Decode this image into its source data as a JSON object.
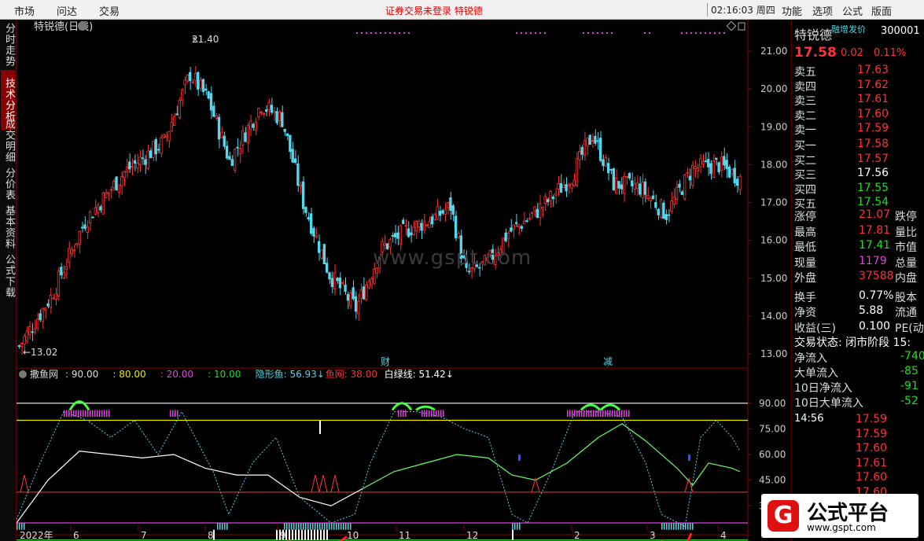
{
  "topbar": {
    "menu_left": [
      "市场",
      "问达",
      "交易"
    ],
    "notice": "证券交易未登录  特锐德",
    "clock": "02:16:03 周四",
    "menu_right": [
      "功能",
      "选项",
      "公式",
      "版面"
    ]
  },
  "left_tabs": [
    {
      "label": "分时走势",
      "active": false
    },
    {
      "label": "技术分析",
      "active": true
    },
    {
      "label": "成交明细",
      "active": false
    },
    {
      "label": "分价表",
      "active": false
    },
    {
      "label": "基本资料",
      "active": false
    },
    {
      "label": "公式下载",
      "active": false
    }
  ],
  "main_chart": {
    "title": "特锐德(日线)",
    "high_label": "21.40",
    "low_label": "←13.02",
    "y_ticks": [
      "21.00",
      "20.00",
      "19.00",
      "18.00",
      "17.00",
      "16.00",
      "15.00",
      "14.00",
      "13.00"
    ],
    "y_values": [
      21,
      20,
      19,
      18,
      17,
      16,
      15,
      14,
      13
    ],
    "event_labels": [
      "财",
      "减"
    ]
  },
  "sub_chart": {
    "indicator_name": "撒鱼网",
    "params": [
      {
        "text": ": 90.00",
        "color": "#dddddd"
      },
      {
        "text": ": 80.00",
        "color": "#e8e800"
      },
      {
        "text": ": 20.00",
        "color": "#e040e0"
      },
      {
        "text": ": 10.00",
        "color": "#22dd22"
      },
      {
        "text": "隐形鱼: 56.93↓",
        "color": "#5cd0e0"
      },
      {
        "text": "鱼网: 38.00",
        "color": "#ff3333"
      },
      {
        "text": "白绿线: 51.42↓",
        "color": "#ffffff"
      }
    ],
    "y_ticks": [
      "90.00",
      "75.00",
      "60.00",
      "45.00",
      "30.00"
    ],
    "y_values": [
      90,
      75,
      60,
      45,
      30
    ]
  },
  "x_axis": [
    "2022年",
    "6",
    "7",
    "8",
    "9",
    "10",
    "11",
    "12",
    "2",
    "3",
    "4"
  ],
  "watermark": "www.gspt.com",
  "quote": {
    "name": "特锐德",
    "badge": "融增发价",
    "code": "300001",
    "price": "17.58",
    "change": "0.02",
    "pct": "0.11%",
    "sell": [
      {
        "label": "卖五",
        "price": "17.63"
      },
      {
        "label": "卖四",
        "price": "17.62"
      },
      {
        "label": "卖三",
        "price": "17.61"
      },
      {
        "label": "卖二",
        "price": "17.60"
      },
      {
        "label": "卖一",
        "price": "17.59"
      }
    ],
    "buy": [
      {
        "label": "买一",
        "price": "17.58"
      },
      {
        "label": "买二",
        "price": "17.57"
      },
      {
        "label": "买三",
        "price": "17.56"
      },
      {
        "label": "买四",
        "price": "17.55"
      },
      {
        "label": "买五",
        "price": "17.54"
      }
    ],
    "stats": [
      {
        "label": "涨停",
        "value": "21.07",
        "extra": "跌停",
        "color": "#ff3333"
      },
      {
        "label": "最高",
        "value": "17.81",
        "extra": "量比",
        "color": "#ff3333"
      },
      {
        "label": "最低",
        "value": "17.41",
        "extra": "市值",
        "color": "#22dd22"
      },
      {
        "label": "现量",
        "value": "1179",
        "extra": "总量",
        "color": "#e040e0"
      },
      {
        "label": "外盘",
        "value": "37588",
        "extra": "内盘",
        "color": "#ff3333"
      },
      {
        "label": "换手",
        "value": "0.77%",
        "extra": "股本",
        "color": "#ffffff"
      },
      {
        "label": "净资",
        "value": "5.88",
        "extra": "流通",
        "color": "#ffffff"
      },
      {
        "label": "收益(三)",
        "value": "0.100",
        "extra": "PE(动)",
        "color": "#ffffff"
      }
    ],
    "status": "交易状态: 闭市阶段 15:",
    "flows": [
      {
        "label": "净流入",
        "value": "-740"
      },
      {
        "label": "大单流入",
        "value": "-85"
      },
      {
        "label": "10日净流入",
        "value": "-91"
      },
      {
        "label": "10日大单流入",
        "value": "-52"
      }
    ],
    "ticks_time": "14:56",
    "ticks": [
      "17.59",
      "17.59",
      "17.60",
      "17.61",
      "17.60",
      "17.60"
    ]
  },
  "logo": {
    "title": "公式平台",
    "url": "www.gspt.com"
  }
}
